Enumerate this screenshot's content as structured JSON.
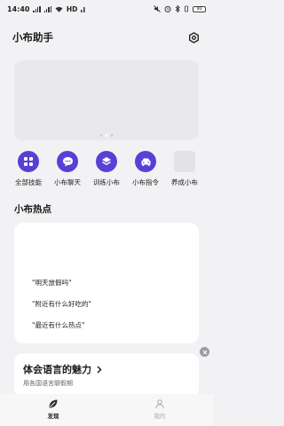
{
  "status_bar": {
    "time": "14:40",
    "network_label": "HD",
    "battery": "90"
  },
  "header": {
    "title": "小布助手",
    "settings_icon": "settings-hexagon-icon"
  },
  "banner": {
    "page_count": 3,
    "active_page": 1
  },
  "skills": [
    {
      "label": "全部技能",
      "icon": "grid-icon"
    },
    {
      "label": "小布聊天",
      "icon": "chat-bubble-icon"
    },
    {
      "label": "训练小布",
      "icon": "layers-icon"
    },
    {
      "label": "小布指令",
      "icon": "car-icon"
    },
    {
      "label": "养成小布",
      "icon": "placeholder-icon"
    }
  ],
  "hot_section": {
    "title": "小布热点",
    "items": [
      "\"明天放假吗\"",
      "\"附近有什么好吃的\"",
      "\"最近有什么热点\""
    ]
  },
  "promo": {
    "title": "体会语言的魅力",
    "subtitle": "用各国语言聊假期"
  },
  "bottom_nav": [
    {
      "label": "发现",
      "active": true
    },
    {
      "label": "我的",
      "active": false
    }
  ],
  "colors": {
    "accent": "#5a3fd6",
    "background": "#f2f2f4"
  }
}
